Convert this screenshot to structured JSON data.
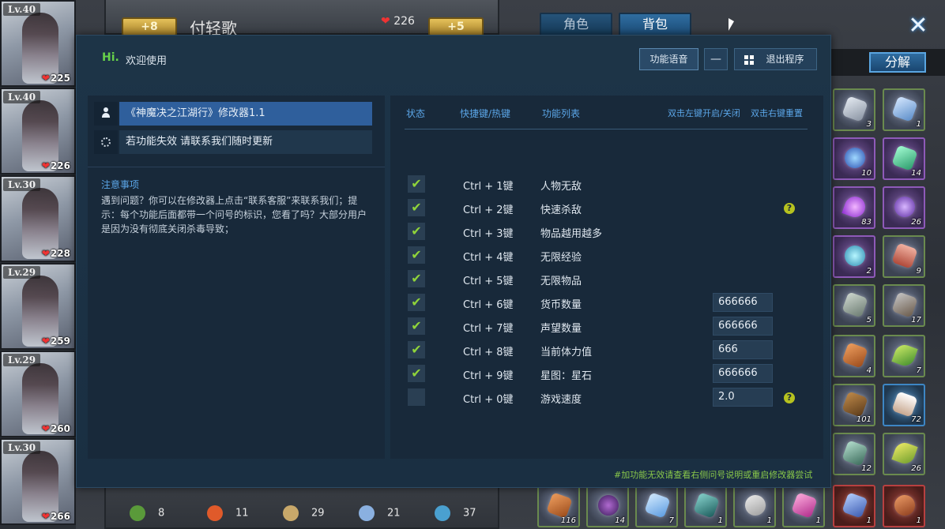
{
  "game": {
    "characters": [
      {
        "level": "Lv.40",
        "hp": "225"
      },
      {
        "level": "Lv.40",
        "hp": "226"
      },
      {
        "level": "Lv.30",
        "hp": "228"
      },
      {
        "level": "Lv.29",
        "hp": "259"
      },
      {
        "level": "Lv.29",
        "hp": "260"
      },
      {
        "level": "Lv.30",
        "hp": "266"
      }
    ],
    "banner": {
      "left_badge": "+8",
      "name": "付轻歌",
      "hp": "226",
      "right_badge": "+5"
    },
    "tabs": {
      "role": "角色",
      "bag": "背包"
    },
    "decompose_label": "分解",
    "inventory_counts": [
      "3",
      "1",
      "10",
      "14",
      "83",
      "26",
      "2",
      "9",
      "5",
      "17",
      "4",
      "7",
      "101",
      "72",
      "12",
      "26"
    ],
    "bottom_row_counts": [
      "116",
      "14",
      "7",
      "1",
      "1",
      "1",
      "1",
      "1"
    ],
    "resources": [
      "8",
      "11",
      "29",
      "21",
      "37"
    ]
  },
  "tool": {
    "hi": "Hi.",
    "welcome": "欢迎使用",
    "buttons": {
      "voice": "功能语音",
      "minimize": "—",
      "exit": "退出程序"
    },
    "title_row": "《神魔决之江湖行》修改器1.1",
    "notice_row": "若功能失效 请联系我们随时更新",
    "notice_title": "注意事项",
    "notice_body": "遇到问题？你可以在修改器上点击“联系客服”来联系我们；提示：每个功能后面都带一个问号的标识，您看了吗？大部分用户是因为没有彻底关闭杀毒导致；",
    "headers": {
      "status": "状态",
      "hotkey": "快捷键/热键",
      "list": "功能列表",
      "left_click": "双击左键开启/关闭",
      "right_click": "双击右键重置"
    },
    "features": [
      {
        "hotkey": "Ctrl + 1键",
        "name": "人物无敌",
        "checked": true,
        "value": "",
        "help": false
      },
      {
        "hotkey": "Ctrl + 2键",
        "name": "快速杀敌",
        "checked": true,
        "value": "",
        "help": true
      },
      {
        "hotkey": "Ctrl + 3键",
        "name": "物品越用越多",
        "checked": true,
        "value": "",
        "help": false
      },
      {
        "hotkey": "Ctrl + 4键",
        "name": "无限经验",
        "checked": true,
        "value": "",
        "help": false
      },
      {
        "hotkey": "Ctrl + 5键",
        "name": "无限物品",
        "checked": true,
        "value": "",
        "help": false
      },
      {
        "hotkey": "Ctrl + 6键",
        "name": "货币数量",
        "checked": true,
        "value": "666666",
        "help": false
      },
      {
        "hotkey": "Ctrl + 7键",
        "name": "声望数量",
        "checked": true,
        "value": "666666",
        "help": false
      },
      {
        "hotkey": "Ctrl + 8键",
        "name": "当前体力值",
        "checked": true,
        "value": "666",
        "help": false
      },
      {
        "hotkey": "Ctrl + 9键",
        "name": "星图：星石",
        "checked": true,
        "value": "666666",
        "help": false
      },
      {
        "hotkey": "Ctrl + 0键",
        "name": "游戏速度",
        "checked": false,
        "value": "2.0",
        "help": true
      }
    ],
    "footer_hint": "#加功能无效请查看右侧问号说明或重启修改器尝试",
    "colors": {
      "accent_green": "#67d24a",
      "header_blue": "#5ba6e8",
      "title_row_bg": "#2f5f9c",
      "check_green": "#8fd33a"
    }
  }
}
